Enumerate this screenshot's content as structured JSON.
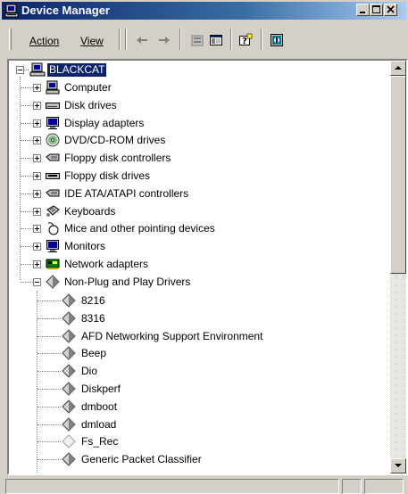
{
  "window": {
    "title": "Device Manager"
  },
  "menu": {
    "action": "Action",
    "view": "View"
  },
  "toolbar": {
    "buttons": [
      "back-arrow-icon",
      "forward-arrow-icon",
      "properties-icon",
      "show-hide-tree-icon",
      "help-icon",
      "scan-hardware-icon"
    ]
  },
  "tree": {
    "root": "BLACKCAT",
    "categories": [
      {
        "label": "Computer",
        "icon": "computer-icon"
      },
      {
        "label": "Disk drives",
        "icon": "disk-drive-icon"
      },
      {
        "label": "Display adapters",
        "icon": "monitor-icon"
      },
      {
        "label": "DVD/CD-ROM drives",
        "icon": "cdrom-icon"
      },
      {
        "label": "Floppy disk controllers",
        "icon": "controller-icon"
      },
      {
        "label": "Floppy disk drives",
        "icon": "floppy-icon"
      },
      {
        "label": "IDE ATA/ATAPI controllers",
        "icon": "controller-icon"
      },
      {
        "label": "Keyboards",
        "icon": "keyboard-icon"
      },
      {
        "label": "Mice and other pointing devices",
        "icon": "mouse-icon"
      },
      {
        "label": "Monitors",
        "icon": "monitor-icon"
      },
      {
        "label": "Network adapters",
        "icon": "network-card-icon"
      },
      {
        "label": "Non-Plug and Play Drivers",
        "icon": "diamond-icon"
      }
    ],
    "drivers": [
      "8216",
      "8316",
      "AFD Networking Support Environment",
      "Beep",
      "Dio",
      "Diskperf",
      "dmboot",
      "dmload",
      "Fs_Rec",
      "Generic Packet Classifier"
    ]
  },
  "colors": {
    "title_bar": "#0a246a",
    "selection": "#0a246a",
    "face": "#d4d0c8"
  }
}
